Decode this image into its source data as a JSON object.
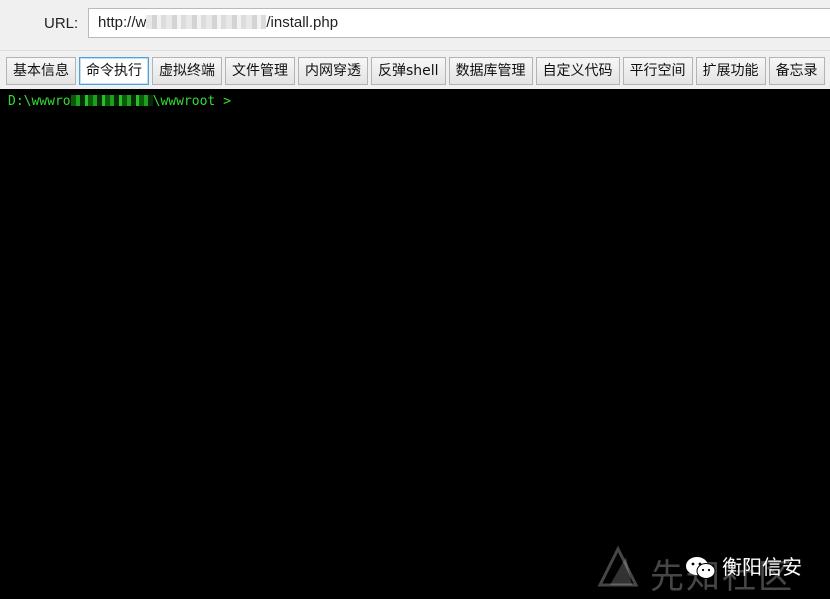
{
  "url_bar": {
    "label": "URL:",
    "url_prefix": "http://w",
    "url_suffix": "/install.php"
  },
  "tabs": [
    {
      "label": "基本信息",
      "active": false
    },
    {
      "label": "命令执行",
      "active": true
    },
    {
      "label": "虚拟终端",
      "active": false
    },
    {
      "label": "文件管理",
      "active": false
    },
    {
      "label": "内网穿透",
      "active": false
    },
    {
      "label": "反弹shell",
      "active": false
    },
    {
      "label": "数据库管理",
      "active": false
    },
    {
      "label": "自定义代码",
      "active": false
    },
    {
      "label": "平行空间",
      "active": false
    },
    {
      "label": "扩展功能",
      "active": false
    },
    {
      "label": "备忘录",
      "active": false
    }
  ],
  "terminal": {
    "prompt_prefix": "D:\\wwwro",
    "prompt_suffix": "\\wwwroot >",
    "text_color": "#33dd33",
    "background": "#000000"
  },
  "watermark": {
    "site_text": "先知社区",
    "brand_text": "衡阳信安"
  },
  "colors": {
    "active_tab_border": "#4da3d9",
    "chrome_background": "#f0f0f0"
  }
}
